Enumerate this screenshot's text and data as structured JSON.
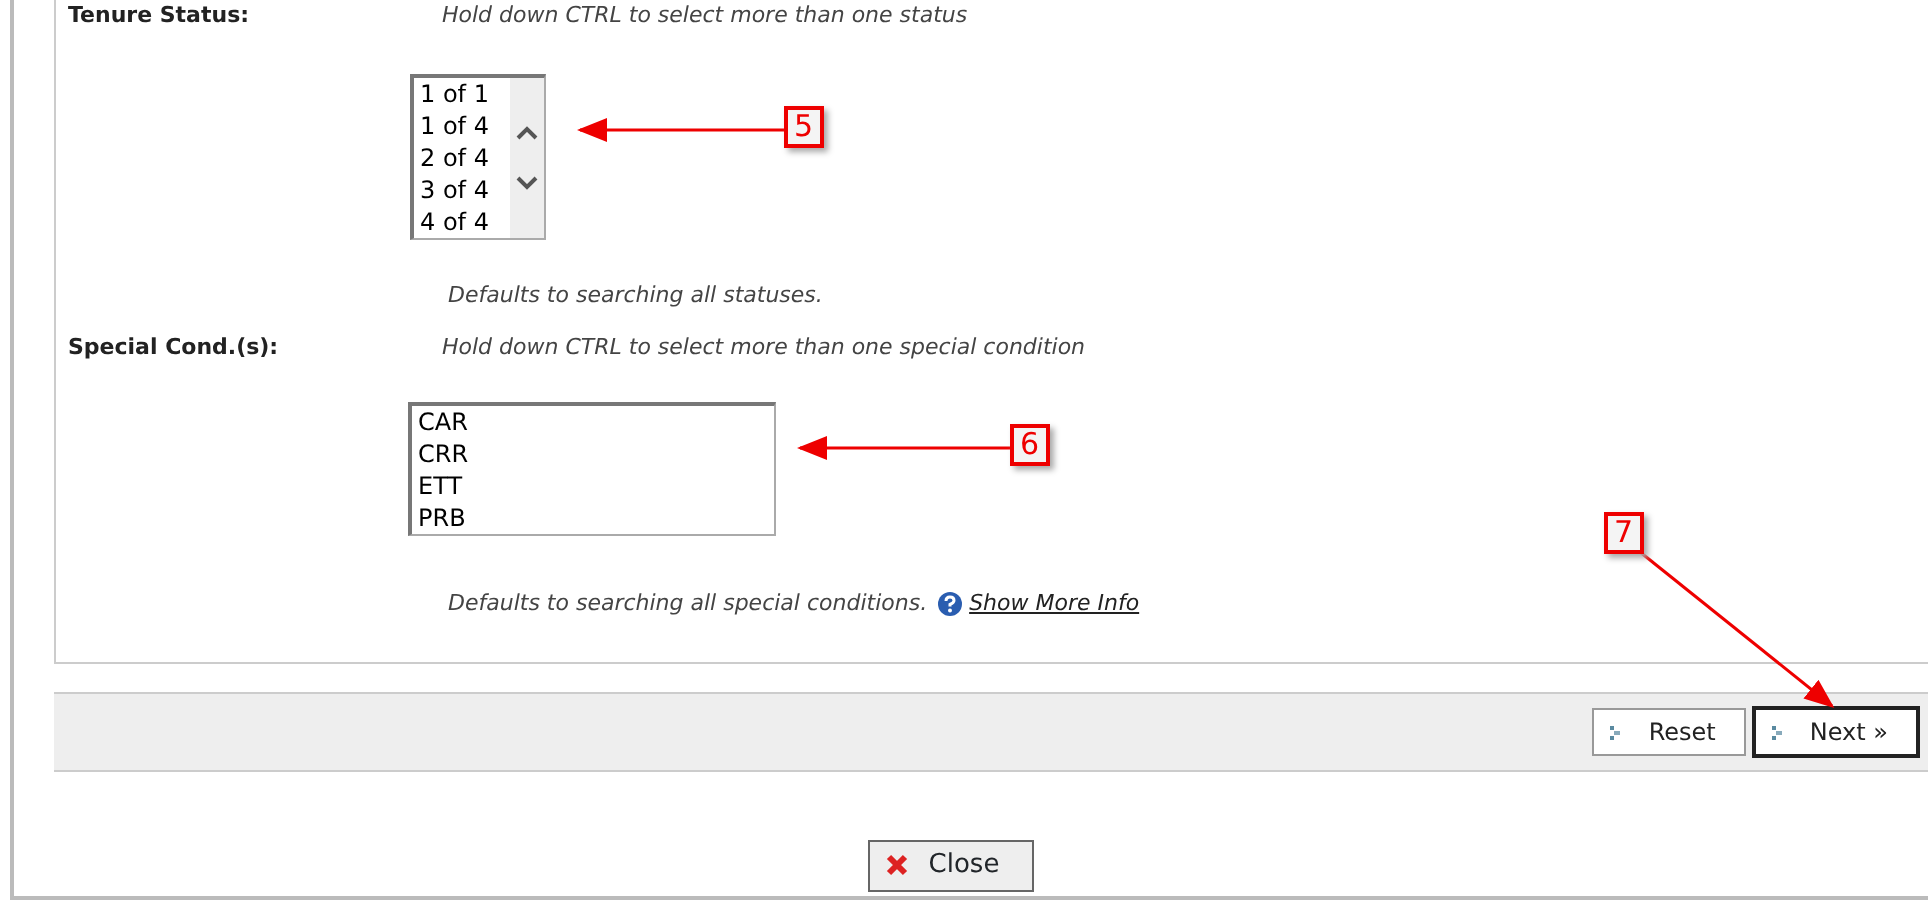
{
  "fields": [
    {
      "label": "Tenure Status:",
      "hint": "Hold down CTRL to select more than one status",
      "options": [
        "1 of 1",
        "1 of 4",
        "2 of 4",
        "3 of 4",
        "4 of 4"
      ],
      "scrollbar": true,
      "note": "Defaults to searching all statuses."
    },
    {
      "label": "Special Cond.(s):",
      "hint": "Hold down CTRL to select more than one special condition",
      "options": [
        "CAR",
        "CRR",
        "ETT",
        "PRB"
      ],
      "scrollbar": false,
      "note": "Defaults to searching all special conditions.",
      "info_link": "Show More Info"
    }
  ],
  "actions": [
    {
      "label": "Reset",
      "primary": false
    },
    {
      "label": "Next »",
      "primary": true
    }
  ],
  "close_button": "Close",
  "callouts": [
    {
      "number": "5"
    },
    {
      "number": "6"
    },
    {
      "number": "7"
    }
  ]
}
